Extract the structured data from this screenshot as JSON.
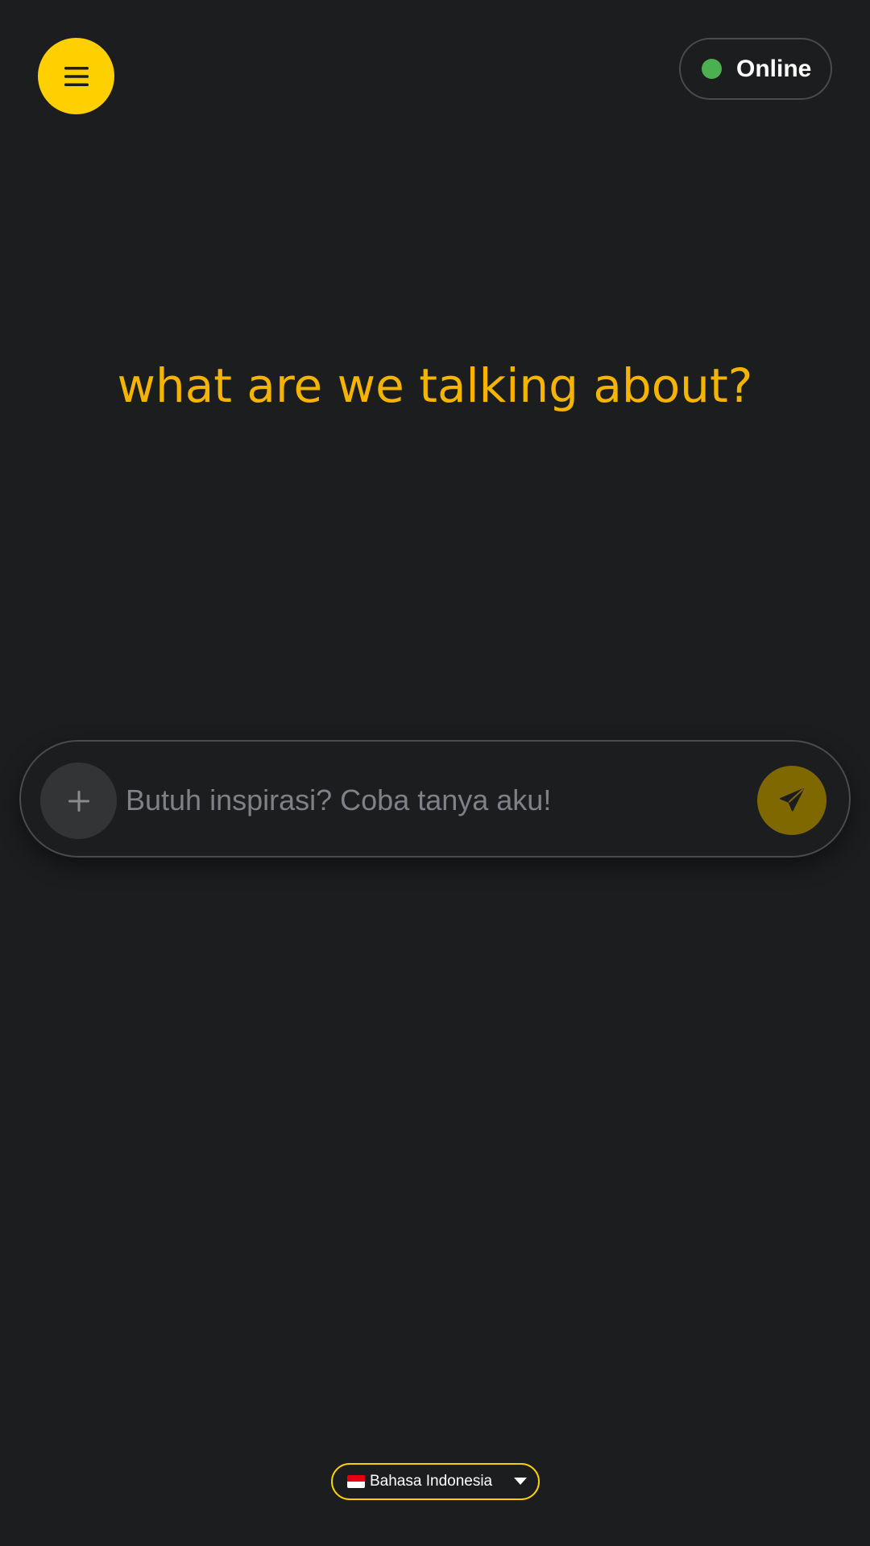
{
  "header": {
    "menu_icon": "hamburger-menu-icon",
    "status": {
      "label": "Online",
      "color": "#4caf50"
    }
  },
  "main": {
    "headline": "what are we talking about?"
  },
  "composer": {
    "attach_icon": "plus-icon",
    "placeholder": "Butuh inspirasi? Coba tanya aku!",
    "value": "",
    "send_icon": "send-icon"
  },
  "footer": {
    "language": {
      "flag": "indonesia-flag-icon",
      "label": "Bahasa Indonesia"
    }
  },
  "colors": {
    "accent": "#ffd000",
    "headline": "#f5b400",
    "background": "#1c1d1f",
    "send_button": "#806800"
  }
}
